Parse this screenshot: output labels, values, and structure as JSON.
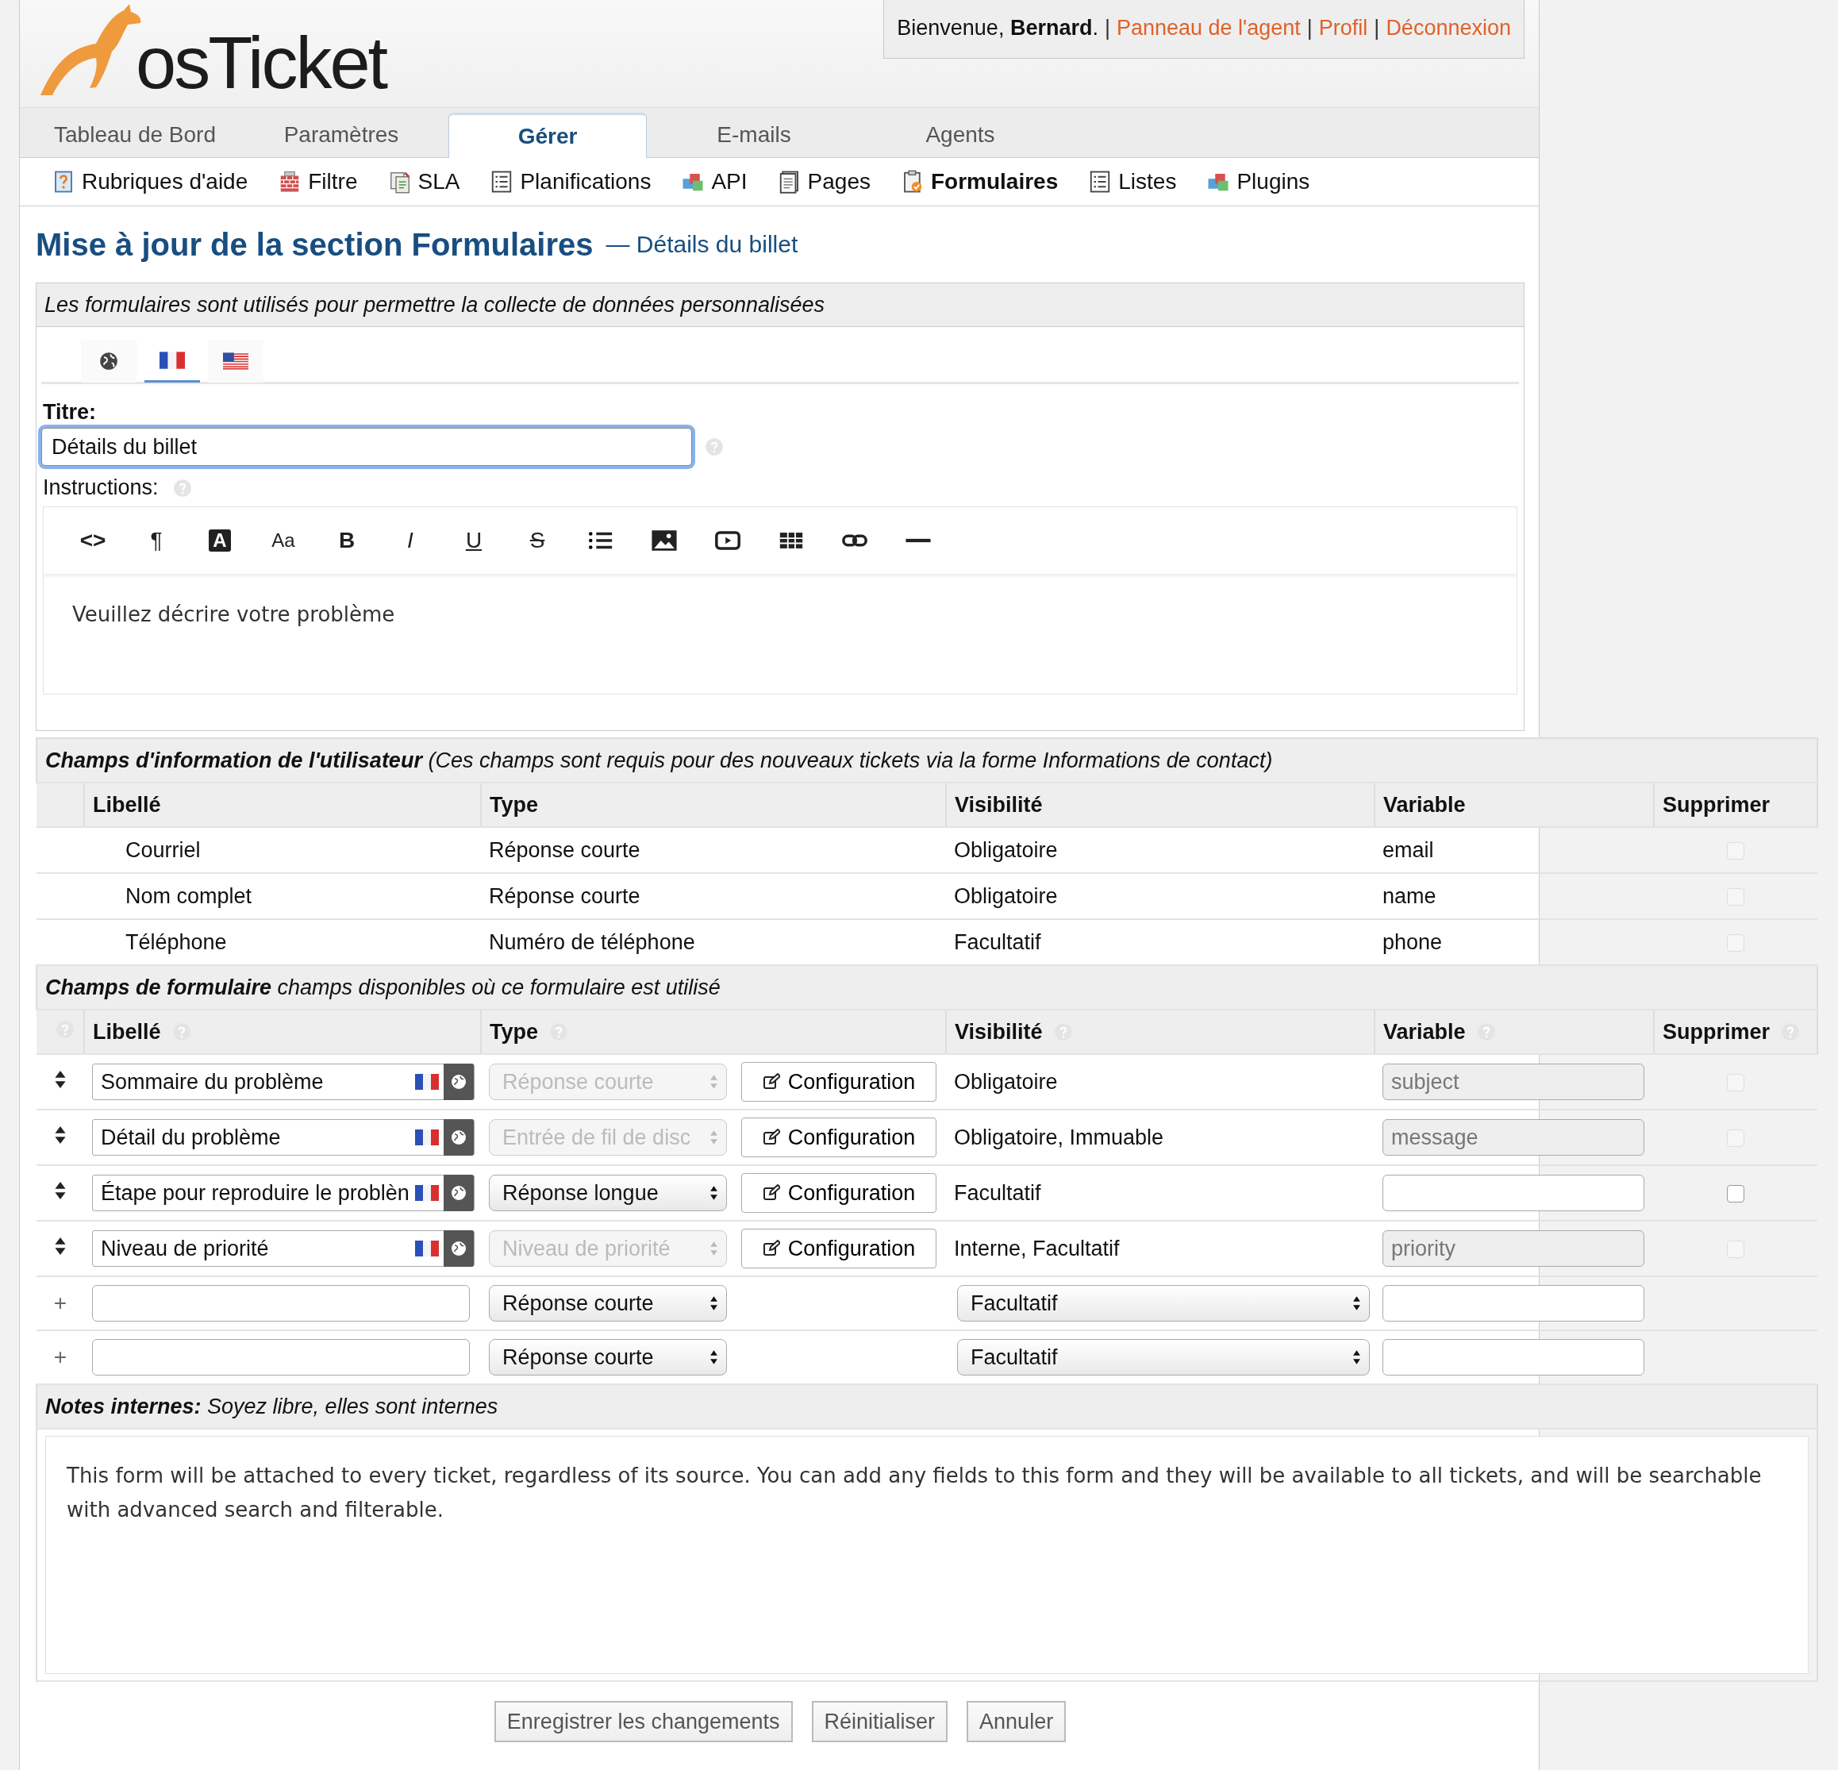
{
  "header": {
    "logo": "os**Ticket**",
    "welcome": "Bienvenue, **Bernard**.",
    "separator": "|",
    "links": [
      "Panneau de l'agent",
      "Profil",
      "Déconnexion"
    ]
  },
  "nav_tabs": [
    {
      "label": "Tableau de Bord",
      "selected": false
    },
    {
      "label": "Paramètres",
      "selected": false
    },
    {
      "label": "Gérer",
      "selected": true
    },
    {
      "label": "E-mails",
      "selected": false
    },
    {
      "label": "Agents",
      "selected": false
    }
  ],
  "sub_nav": [
    {
      "label": "Rubriques d'aide",
      "selected": false
    },
    {
      "label": "Filtre",
      "selected": false
    },
    {
      "label": "SLA",
      "selected": false
    },
    {
      "label": "Planifications",
      "selected": false
    },
    {
      "label": "API",
      "selected": false
    },
    {
      "label": "Pages",
      "selected": false
    },
    {
      "label": "Formulaires",
      "selected": true
    },
    {
      "label": "Listes",
      "selected": false
    },
    {
      "label": "Plugins",
      "selected": false
    }
  ],
  "page_title": "Mise à jour de la section Formulaires",
  "page_subtitle": "— Détails du billet",
  "form": {
    "description": "Les formulaires sont utilisés pour permettre la collecte de données personnalisées",
    "language_tabs": [
      {
        "selected": false
      },
      {
        "selected": true
      },
      {
        "selected": false
      }
    ],
    "title_label": "Titre:",
    "title_value": "Détails du billet",
    "instructions_label": "Instructions:",
    "editor_toolbar": [
      "<>",
      "¶",
      "A",
      "Aa",
      "B",
      "I",
      "U",
      "S"
    ],
    "editor_content": "Veuillez décrire votre problème"
  },
  "user_fields": {
    "heading": "**Champs d'information de l'utilisateur** (Ces champs sont requis pour des nouveaux tickets via la forme Informations de contact)",
    "columns": [
      "Libellé",
      "Type",
      "Visibilité",
      "Variable",
      "Supprimer"
    ],
    "rows": [
      {
        "label": "Courriel",
        "type": "Réponse courte",
        "visibility": "Obligatoire",
        "variable": "email",
        "checked": false,
        "disabled": true
      },
      {
        "label": "Nom complet",
        "type": "Réponse courte",
        "visibility": "Obligatoire",
        "variable": "name",
        "checked": false,
        "disabled": true
      },
      {
        "label": "Téléphone",
        "type": "Numéro de téléphone",
        "visibility": "Facultatif",
        "variable": "phone",
        "checked": false,
        "disabled": true
      }
    ]
  },
  "form_fields": {
    "heading": "**Champs de formulaire** champs disponibles où ce formulaire est utilisé",
    "columns": [
      "Libellé",
      "Type",
      "Visibilité",
      "Variable",
      "Supprimer"
    ],
    "rows": [
      {
        "kind": "existing",
        "label": "Sommaire du problème",
        "type": "Réponse courte",
        "type_disabled": true,
        "config": "Configuration",
        "visibility": "Obligatoire",
        "variable": "subject",
        "variable_disabled": true,
        "checked": false,
        "disabled": true
      },
      {
        "kind": "existing",
        "label": "Détail du problème",
        "type": "Entrée de fil de disc",
        "type_disabled": true,
        "config": "Configuration",
        "visibility": "Obligatoire, Immuable",
        "variable": "message",
        "variable_disabled": true,
        "checked": false,
        "disabled": true
      },
      {
        "kind": "existing",
        "label": "Étape pour reproduire le problèn",
        "type": "Réponse longue",
        "type_disabled": false,
        "config": "Configuration",
        "visibility": "Facultatif",
        "variable_disabled": false,
        "checked": false,
        "disabled": false
      },
      {
        "kind": "existing",
        "label": "Niveau de priorité",
        "type": "Niveau de priorité",
        "type_disabled": true,
        "config": "Configuration",
        "visibility": "Interne, Facultatif",
        "variable": "priority",
        "variable_disabled": true,
        "checked": false,
        "disabled": true
      },
      {
        "kind": "new",
        "handle": "+",
        "type": "Réponse courte",
        "visibility": "Facultatif"
      },
      {
        "kind": "new",
        "handle": "+",
        "type": "Réponse courte",
        "visibility": "Facultatif"
      }
    ]
  },
  "notes": {
    "heading": "**Notes internes:** Soyez libre, elles sont internes",
    "content": "This form will be attached to every ticket, regardless of its source. You can add any fields to this form and they will be available to all tickets, and will be searchable with advanced search and filterable."
  },
  "buttons": [
    "Enregistrer les changements",
    "Réinitialiser",
    "Annuler"
  ]
}
